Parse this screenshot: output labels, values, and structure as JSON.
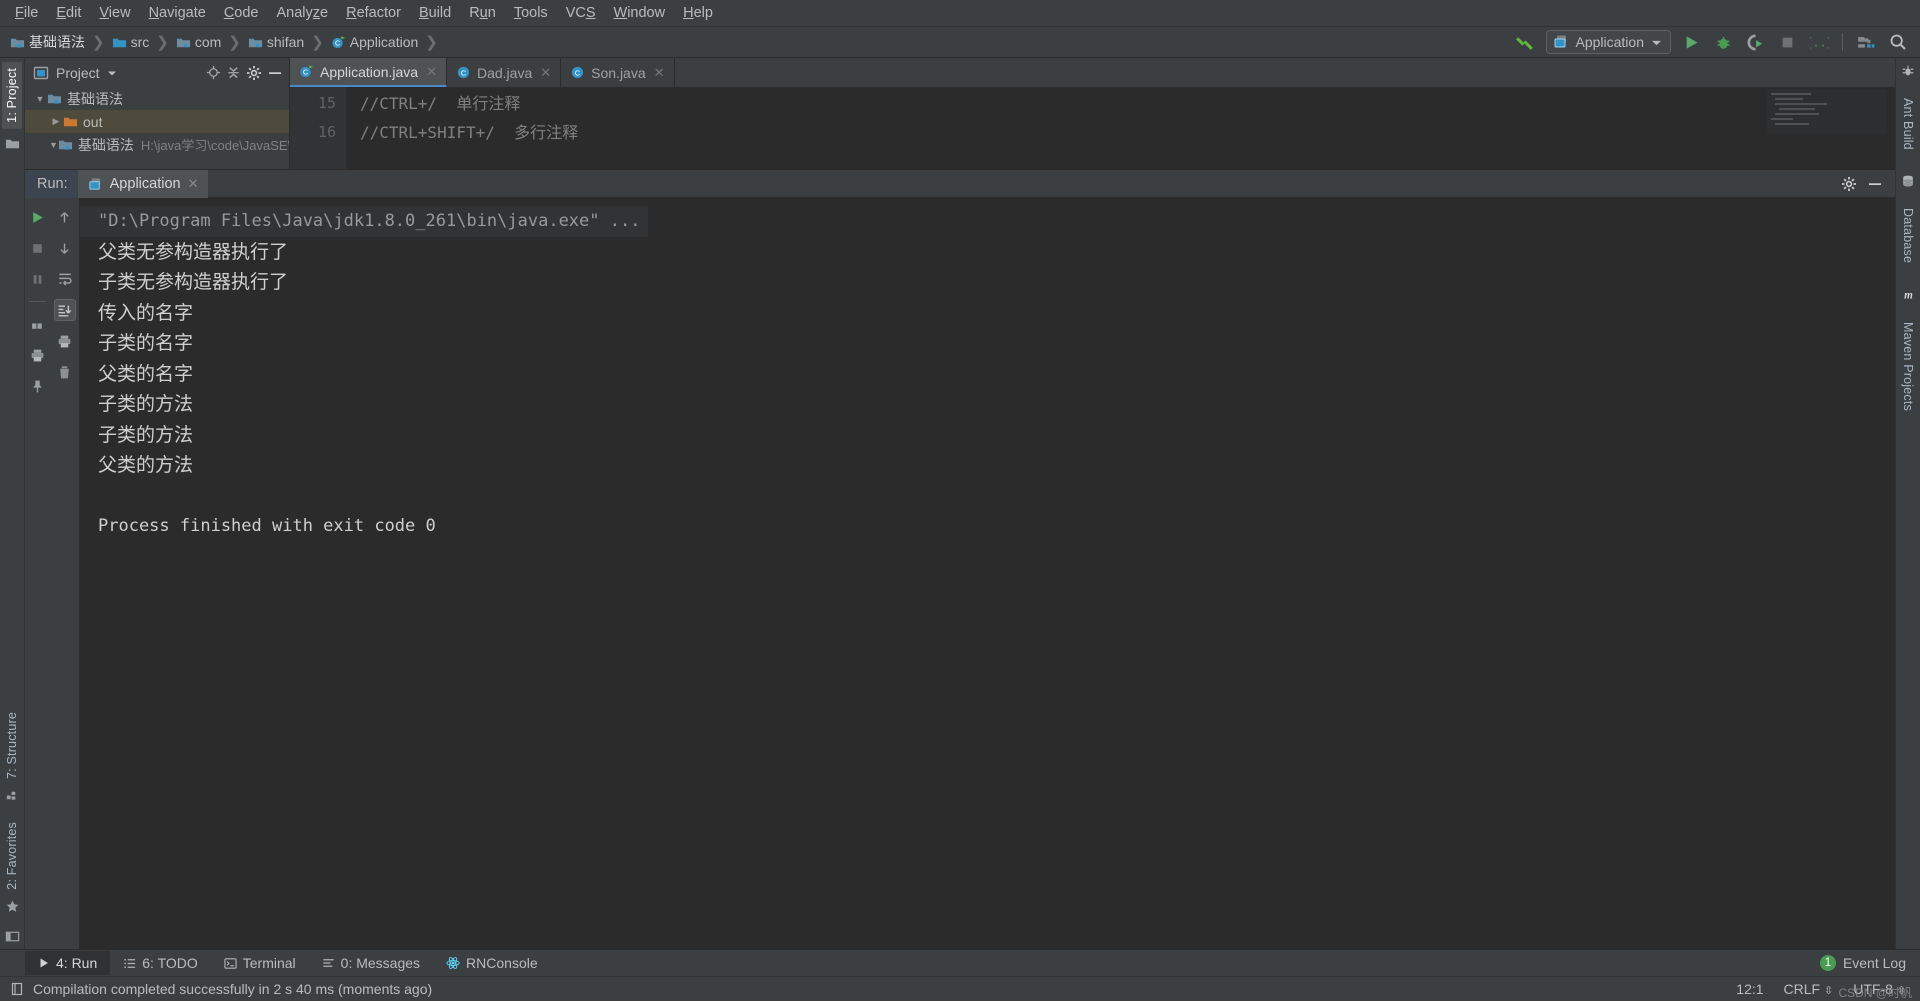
{
  "menubar": {
    "items": [
      {
        "label": "File",
        "mnemonic": "F"
      },
      {
        "label": "Edit",
        "mnemonic": "E"
      },
      {
        "label": "View",
        "mnemonic": "V"
      },
      {
        "label": "Navigate",
        "mnemonic": "N"
      },
      {
        "label": "Code",
        "mnemonic": "C"
      },
      {
        "label": "Analyze",
        "mnemonic": "z"
      },
      {
        "label": "Refactor",
        "mnemonic": "R"
      },
      {
        "label": "Build",
        "mnemonic": "B"
      },
      {
        "label": "Run",
        "mnemonic": "u"
      },
      {
        "label": "Tools",
        "mnemonic": "T"
      },
      {
        "label": "VCS",
        "mnemonic": "S"
      },
      {
        "label": "Window",
        "mnemonic": "W"
      },
      {
        "label": "Help",
        "mnemonic": "H"
      }
    ]
  },
  "navbar": {
    "breadcrumbs": [
      {
        "label": "基础语法",
        "icon": "module-icon"
      },
      {
        "label": "src",
        "icon": "source-folder-icon"
      },
      {
        "label": "com",
        "icon": "package-icon"
      },
      {
        "label": "shifan",
        "icon": "package-icon"
      },
      {
        "label": "Application",
        "icon": "java-class-icon"
      }
    ],
    "run_config": "Application",
    "buttons": [
      {
        "name": "run-button",
        "glyph": "run"
      },
      {
        "name": "debug-button",
        "glyph": "debug"
      },
      {
        "name": "run-coverage-button",
        "glyph": "coverage"
      },
      {
        "name": "stop-button",
        "glyph": "stop"
      },
      {
        "name": "code-braces-button",
        "glyph": "braces"
      },
      {
        "name": "project-structure-button",
        "glyph": "structure"
      },
      {
        "name": "search-everywhere-button",
        "glyph": "search"
      }
    ]
  },
  "left_strip": {
    "top_tabs": [
      {
        "label": "1: Project",
        "selected": true
      }
    ],
    "bottom_tabs": [
      {
        "label": "7: Structure",
        "selected": false
      },
      {
        "label": "2: Favorites",
        "selected": false
      }
    ]
  },
  "right_strip": {
    "tabs": [
      {
        "label": "Ant Build",
        "icon": "ant-icon"
      },
      {
        "label": "Database",
        "icon": "database-icon"
      },
      {
        "label": "Maven Projects",
        "icon": "maven-icon"
      }
    ]
  },
  "project_panel": {
    "title": "Project",
    "header_icons": [
      "locate-icon",
      "collapse-all-icon",
      "settings-icon",
      "hide-icon"
    ],
    "tree": [
      {
        "label": "基础语法",
        "depth": 0,
        "twisty": "▼",
        "icon": "module-icon",
        "selected": false,
        "path": ""
      },
      {
        "label": "out",
        "depth": 1,
        "twisty": "▶",
        "icon": "folder-orange-icon",
        "selected": true,
        "path": ""
      },
      {
        "label": "基础语法",
        "depth": 1,
        "twisty": "▼",
        "icon": "module-icon",
        "selected": false,
        "path": "H:\\java学习\\code\\JavaSE\\基"
      }
    ]
  },
  "editor": {
    "tabs": [
      {
        "label": "Application.java",
        "icon": "java-runnable-icon",
        "active": true
      },
      {
        "label": "Dad.java",
        "icon": "java-class-icon",
        "active": false
      },
      {
        "label": "Son.java",
        "icon": "java-class-icon",
        "active": false
      }
    ],
    "gutter_lines": [
      "15",
      "16"
    ],
    "code_lines": [
      "//CTRL+/  单行注释",
      "//CTRL+SHIFT+/  多行注释"
    ]
  },
  "run_window": {
    "label": "Run:",
    "tab": "Application",
    "tab_icon": "run-config-icon",
    "toolbar_left": [
      {
        "name": "rerun-button",
        "glyph": "run-green"
      },
      {
        "name": "stop-button",
        "glyph": "stop-square"
      },
      {
        "name": "pause-button",
        "glyph": "pause"
      },
      {
        "name": "layout-button",
        "glyph": "layout"
      },
      {
        "name": "pin-button",
        "glyph": "pin"
      }
    ],
    "toolbar_right": [
      {
        "name": "up-stacktrace-button",
        "glyph": "arrow-up"
      },
      {
        "name": "down-stacktrace-button",
        "glyph": "arrow-down"
      },
      {
        "name": "soft-wrap-button",
        "glyph": "wrap"
      },
      {
        "name": "scroll-to-end-button",
        "glyph": "scroll-end"
      },
      {
        "name": "print-button",
        "glyph": "print"
      },
      {
        "name": "clear-all-button",
        "glyph": "trash"
      }
    ],
    "header_icons": [
      "settings-icon",
      "hide-icon"
    ],
    "console_lines": [
      {
        "text": "\"D:\\Program Files\\Java\\jdk1.8.0_261\\bin\\java.exe\" ...",
        "type": "command"
      },
      {
        "text": "父类无参构造器执行了",
        "type": "cjk"
      },
      {
        "text": "子类无参构造器执行了",
        "type": "cjk"
      },
      {
        "text": "传入的名字",
        "type": "cjk"
      },
      {
        "text": "子类的名字",
        "type": "cjk"
      },
      {
        "text": "父类的名字",
        "type": "cjk"
      },
      {
        "text": "子类的方法",
        "type": "cjk"
      },
      {
        "text": "子类的方法",
        "type": "cjk"
      },
      {
        "text": "父类的方法",
        "type": "cjk"
      },
      {
        "text": "",
        "type": "blank"
      },
      {
        "text": "Process finished with exit code 0",
        "type": "plain"
      }
    ]
  },
  "bottom_bar": {
    "tabs": [
      {
        "label": "4: Run",
        "mnemonic": "4",
        "rest": ": Run",
        "icon": "play-icon",
        "selected": true
      },
      {
        "label": "6: TODO",
        "mnemonic": "6",
        "rest": ": TODO",
        "icon": "todo-icon",
        "selected": false
      },
      {
        "label": "Terminal",
        "mnemonic": "",
        "rest": "Terminal",
        "icon": "terminal-icon",
        "selected": false
      },
      {
        "label": "0: Messages",
        "mnemonic": "0",
        "rest": ": Messages",
        "icon": "messages-icon",
        "selected": false
      },
      {
        "label": "RNConsole",
        "mnemonic": "",
        "rest": "RNConsole",
        "icon": "react-icon",
        "selected": false
      }
    ],
    "event_log": {
      "label": "Event Log",
      "count": "1"
    }
  },
  "status_bar": {
    "message": "Compilation completed successfully in 2 s 40 ms (moments ago)",
    "caret": "12:1",
    "line_separator": "CRLF",
    "encoding": "UTF-8",
    "watermark": "CSDN @时帆"
  },
  "colors": {
    "accent_blue": "#4a88c7",
    "green": "#499c54",
    "panel_bg": "#3c3f41",
    "editor_bg": "#2b2b2b",
    "selection": "#4e4b3c",
    "text": "#bbbbbb"
  }
}
